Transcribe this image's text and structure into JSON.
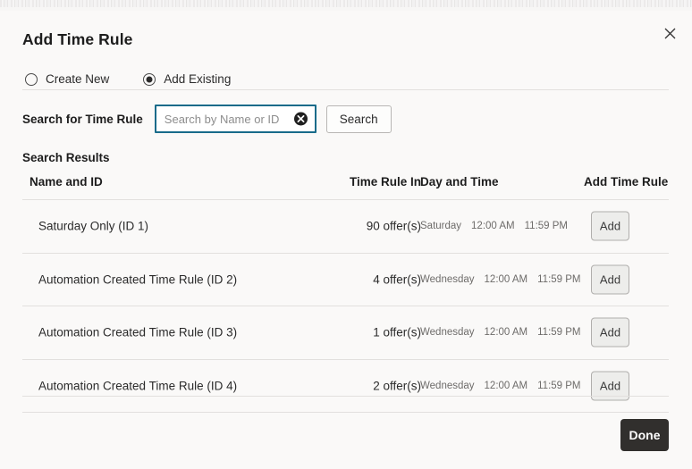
{
  "dialog": {
    "title": "Add Time Rule",
    "close_icon": "close-icon"
  },
  "mode_options": [
    {
      "label": "Create New",
      "selected": false
    },
    {
      "label": "Add Existing",
      "selected": true
    }
  ],
  "search": {
    "label": "Search for Time Rule",
    "value": "",
    "placeholder": "Search by Name or ID",
    "clear_icon": "clear-circle-icon",
    "button_label": "Search"
  },
  "results": {
    "label": "Search Results",
    "columns": {
      "name": "Name and ID",
      "time_rule_in": "Time Rule In",
      "day_and_time": "Day and Time",
      "add_time_rule": "Add Time Rule"
    },
    "rows": [
      {
        "name": "Saturday Only (ID 1)",
        "time_rule_in": "90 offer(s)",
        "day": "Saturday",
        "start_time": "12:00 AM",
        "end_time": "11:59 PM",
        "add_label": "Add"
      },
      {
        "name": "Automation Created Time Rule (ID 2)",
        "time_rule_in": "4 offer(s)",
        "day": "Wednesday",
        "start_time": "12:00 AM",
        "end_time": "11:59 PM",
        "add_label": "Add"
      },
      {
        "name": "Automation Created Time Rule (ID 3)",
        "time_rule_in": "1 offer(s)",
        "day": "Wednesday",
        "start_time": "12:00 AM",
        "end_time": "11:59 PM",
        "add_label": "Add"
      },
      {
        "name": "Automation Created Time Rule (ID 4)",
        "time_rule_in": "2 offer(s)",
        "day": "Wednesday",
        "start_time": "12:00 AM",
        "end_time": "11:59 PM",
        "add_label": "Add"
      }
    ]
  },
  "footer": {
    "done_label": "Done"
  },
  "colors": {
    "background": "#faf9f8",
    "input_focus_border": "#186b8a",
    "primary_button": "#312f2d",
    "divider": "#e2e0de",
    "muted_text": "#6e6c6a"
  }
}
